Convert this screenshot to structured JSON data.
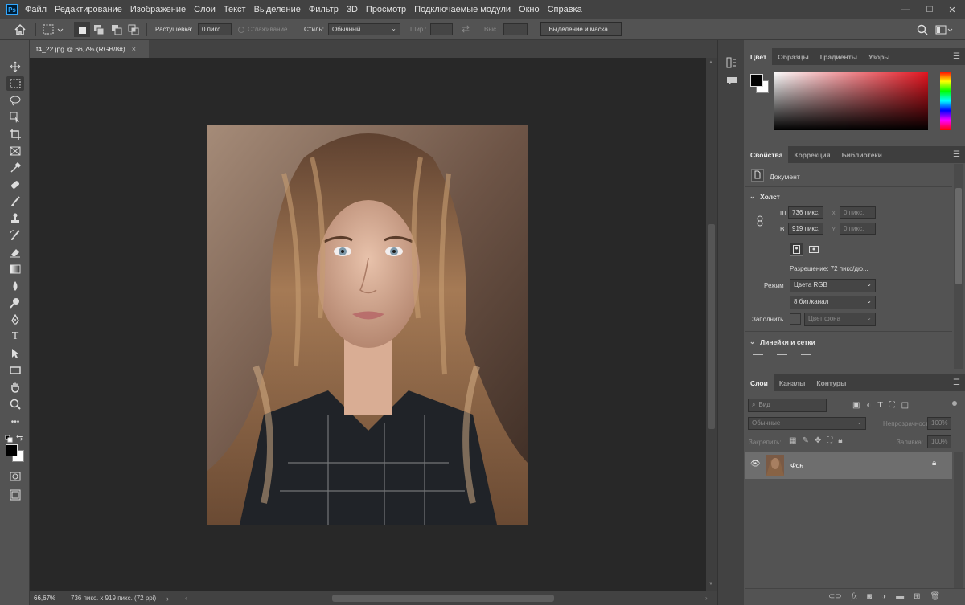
{
  "app": {
    "logo": "Ps"
  },
  "menu": [
    "Файл",
    "Редактирование",
    "Изображение",
    "Слои",
    "Текст",
    "Выделение",
    "Фильтр",
    "3D",
    "Просмотр",
    "Подключаемые модули",
    "Окно",
    "Справка"
  ],
  "window_controls": {
    "minimize": "—",
    "maximize": "☐",
    "close": "✕"
  },
  "options": {
    "feather_label": "Растушевка:",
    "feather_value": "0 пикс.",
    "antialias_label": "Сглаживание",
    "style_label": "Стиль:",
    "style_value": "Обычный",
    "width_label": "Шир.:",
    "height_label": "Выс.:",
    "select_mask_button": "Выделение и маска..."
  },
  "document_tab": {
    "title": "f4_22.jpg @ 66,7% (RGB/8#)",
    "close": "×"
  },
  "status": {
    "zoom": "66,67%",
    "info": "736 пикс. x 919 пикс. (72 ppi)"
  },
  "color_panel": {
    "tabs": [
      "Цвет",
      "Образцы",
      "Градиенты",
      "Узоры"
    ],
    "foreground": "#000000",
    "background": "#ffffff"
  },
  "properties_panel": {
    "tabs": [
      "Свойства",
      "Коррекция",
      "Библиотеки"
    ],
    "doc_label": "Документ",
    "canvas_section": "Холст",
    "w_label": "Ш",
    "w_value": "736 пикс.",
    "h_label": "В",
    "h_value": "919 пикс.",
    "x_label": "X",
    "x_placeholder": "0 пикс.",
    "y_label": "Y",
    "y_placeholder": "0 пикс.",
    "resolution": "Разрешение: 72 пикс/дю...",
    "mode_label": "Режим",
    "mode_value": "Цвета RGB",
    "depth_value": "8 бит/канал",
    "fill_label": "Заполнить",
    "fill_value": "Цвет фона",
    "rulers_section": "Линейки и сетки"
  },
  "layers_panel": {
    "tabs": [
      "Слои",
      "Каналы",
      "Контуры"
    ],
    "search_placeholder": "Вид",
    "blend_mode": "Обычные",
    "opacity_label": "Непрозрачность:",
    "opacity_value": "100%",
    "lock_label": "Закрепить:",
    "fill_label": "Заливка:",
    "fill_value": "100%",
    "layers": [
      {
        "name": "Фон",
        "visible": true,
        "locked": true
      }
    ]
  }
}
